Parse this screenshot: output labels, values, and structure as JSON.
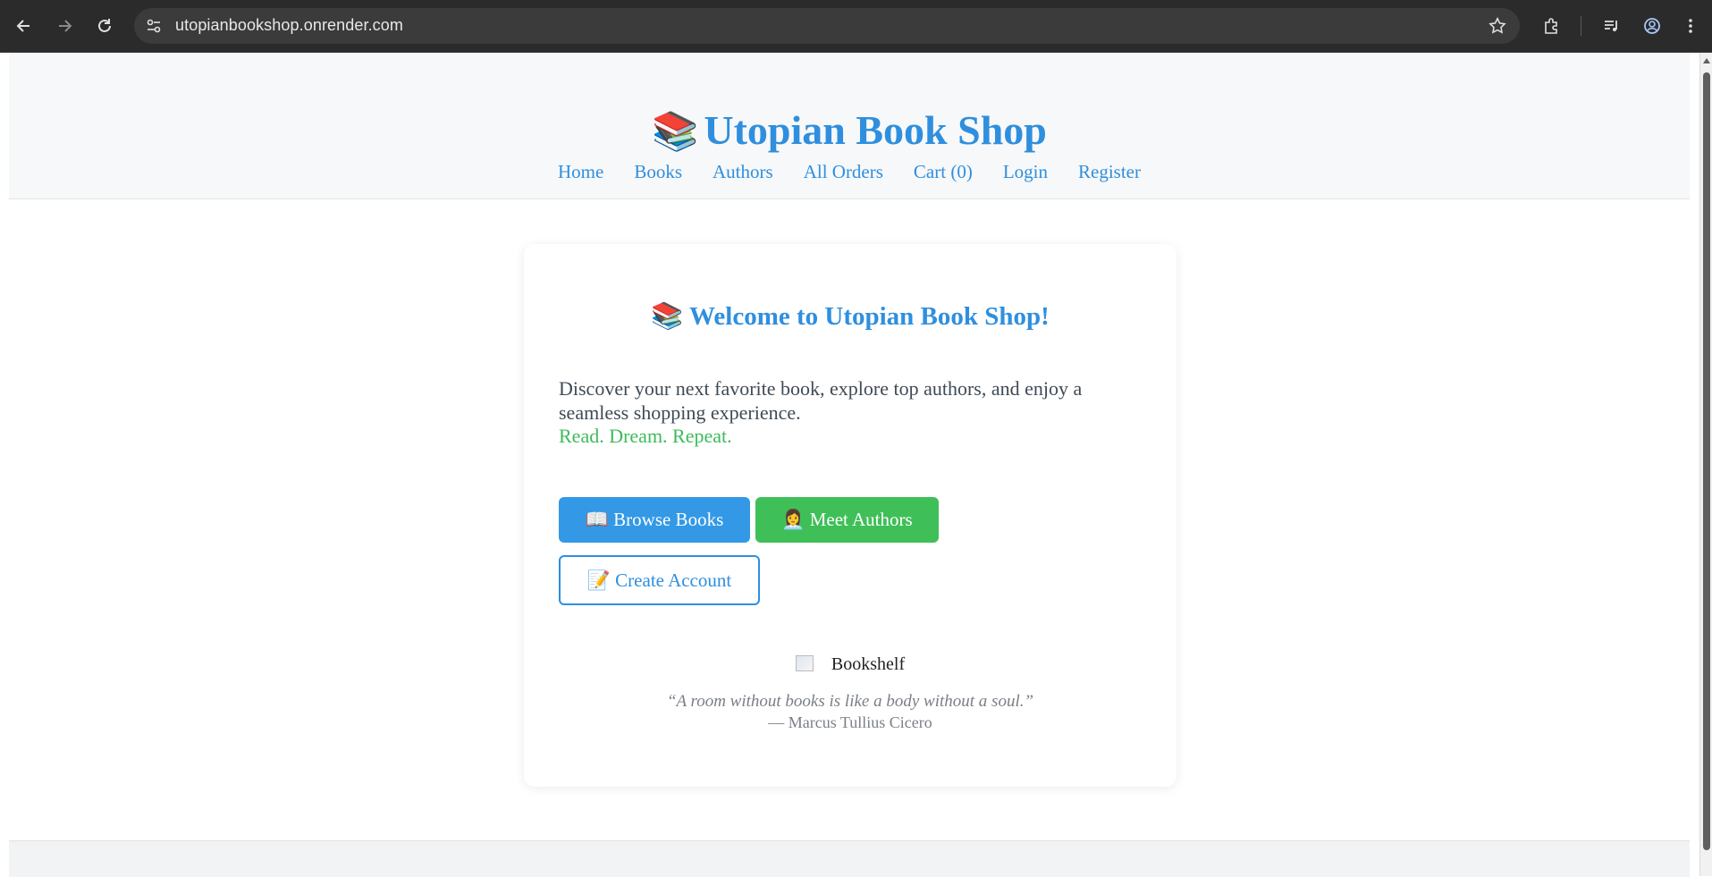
{
  "browser": {
    "url": "utopianbookshop.onrender.com"
  },
  "site": {
    "logo_emoji": "📚",
    "title": "Utopian Book Shop",
    "nav": [
      {
        "label": "Home"
      },
      {
        "label": "Books"
      },
      {
        "label": "Authors"
      },
      {
        "label": "All Orders"
      },
      {
        "label": "Cart (0)"
      },
      {
        "label": "Login"
      },
      {
        "label": "Register"
      }
    ]
  },
  "hero": {
    "emoji": "📚",
    "heading": "Welcome to Utopian Book Shop!",
    "intro": "Discover your next favorite book, explore top authors, and enjoy a seamless shopping experience.",
    "tagline": "Read. Dream. Repeat.",
    "buttons": {
      "browse": "📖 Browse Books",
      "authors": "👩‍💼 Meet Authors",
      "create": "📝 Create Account"
    },
    "image_alt": "Bookshelf",
    "quote": "“A room without books is like a body without a soul.”",
    "quote_author": "— Marcus Tullius Cicero"
  },
  "colors": {
    "primary": "#2f8fde",
    "success": "#3fbf58",
    "header_bg": "#f7f8f9"
  }
}
